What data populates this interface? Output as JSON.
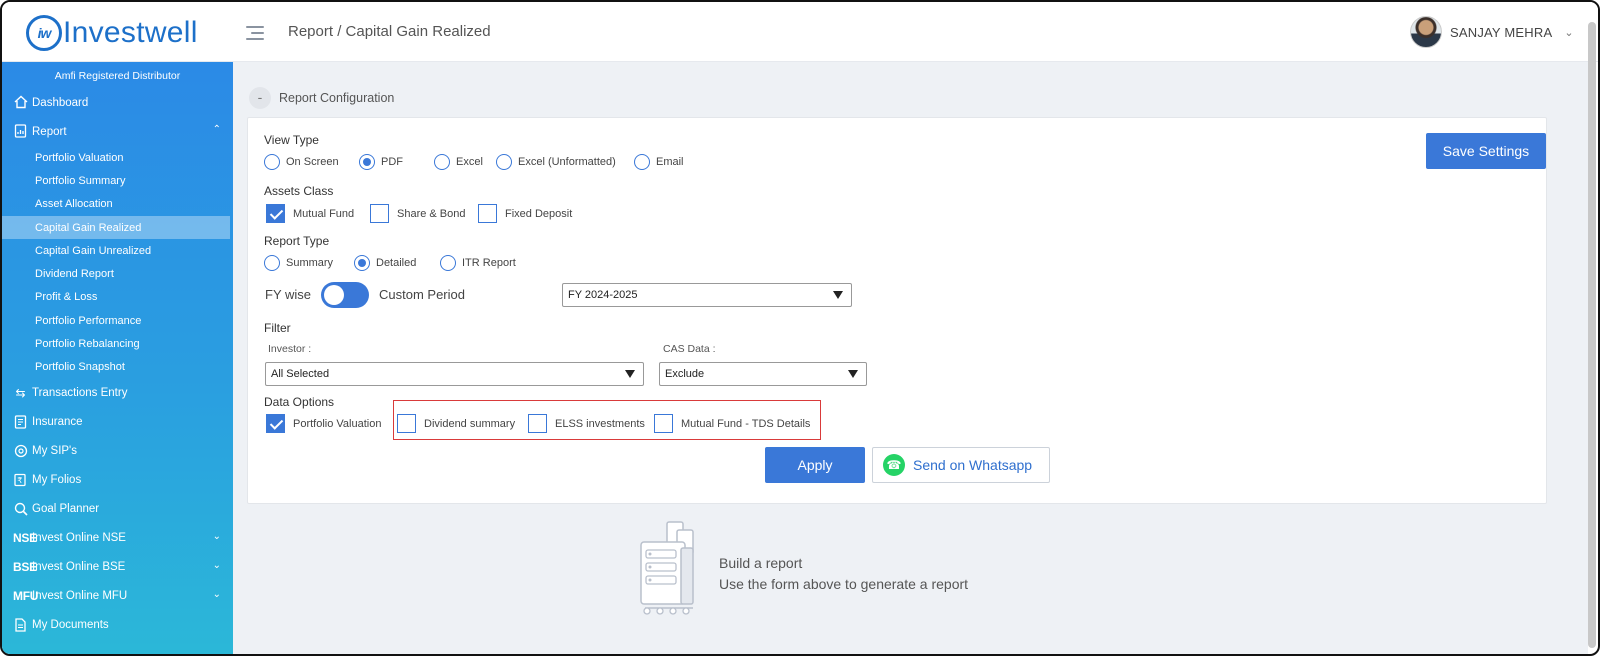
{
  "header": {
    "logo_mark": "iw",
    "logo_text": "Investwell",
    "breadcrumb": "Report / Capital Gain Realized",
    "user_name": "SANJAY MEHRA"
  },
  "sidebar": {
    "top_label": "Amfi Registered Distributor",
    "items": [
      {
        "label": "Dashboard",
        "icon": "home-icon"
      },
      {
        "label": "Report",
        "icon": "report-icon"
      },
      {
        "label": "Transactions Entry",
        "icon": "swap-icon"
      },
      {
        "label": "Insurance",
        "icon": "insurance-icon"
      },
      {
        "label": "My SIP's",
        "icon": "sip-icon"
      },
      {
        "label": "My Folios",
        "icon": "folio-icon"
      },
      {
        "label": "Goal Planner",
        "icon": "goal-icon"
      },
      {
        "label": "Invest Online NSE",
        "icon": "nse-icon",
        "tag": "NSE"
      },
      {
        "label": "Invest Online BSE",
        "icon": "bse-icon",
        "tag": "BSE"
      },
      {
        "label": "Invest Online MFU",
        "icon": "mfu-icon",
        "tag": "MFU"
      },
      {
        "label": "My Documents",
        "icon": "documents-icon"
      }
    ],
    "report_sub": [
      "Portfolio Valuation",
      "Portfolio Summary",
      "Asset Allocation",
      "Capital Gain Realized",
      "Capital Gain Unrealized",
      "Dividend Report",
      "Profit & Loss",
      "Portfolio Performance",
      "Portfolio Rebalancing",
      "Portfolio Snapshot"
    ],
    "active_sub": "Capital Gain Realized"
  },
  "config": {
    "title": "Report Configuration",
    "collapse_symbol": "-",
    "save_label": "Save Settings",
    "view_type": {
      "label": "View Type",
      "options": [
        "On Screen",
        "PDF",
        "Excel",
        "Excel (Unformatted)",
        "Email"
      ],
      "selected": "PDF"
    },
    "assets_class": {
      "label": "Assets Class",
      "options": [
        "Mutual Fund",
        "Share & Bond",
        "Fixed Deposit"
      ],
      "checked": [
        "Mutual Fund"
      ]
    },
    "report_type": {
      "label": "Report Type",
      "options": [
        "Summary",
        "Detailed",
        "ITR Report"
      ],
      "selected": "Detailed"
    },
    "period": {
      "left_label": "FY wise",
      "right_label": "Custom Period",
      "toggle_state": "FY wise",
      "fy_value": "FY 2024-2025"
    },
    "filter": {
      "label": "Filter",
      "investor_label": "Investor :",
      "investor_value": "All Selected",
      "cas_label": "CAS Data :",
      "cas_value": "Exclude"
    },
    "data_options": {
      "label": "Data Options",
      "options": [
        "Portfolio Valuation",
        "Dividend summary",
        "ELSS investments",
        "Mutual Fund - TDS Details"
      ],
      "checked": [
        "Portfolio Valuation"
      ]
    },
    "apply_label": "Apply",
    "whatsapp_label": "Send on Whatsapp"
  },
  "empty_state": {
    "title": "Build a report",
    "subtitle": "Use the form above to generate a report"
  },
  "colors": {
    "brand": "#1d70c9",
    "accent": "#3a78d8",
    "highlight": "#d93a3a",
    "whatsapp": "#25d366"
  }
}
